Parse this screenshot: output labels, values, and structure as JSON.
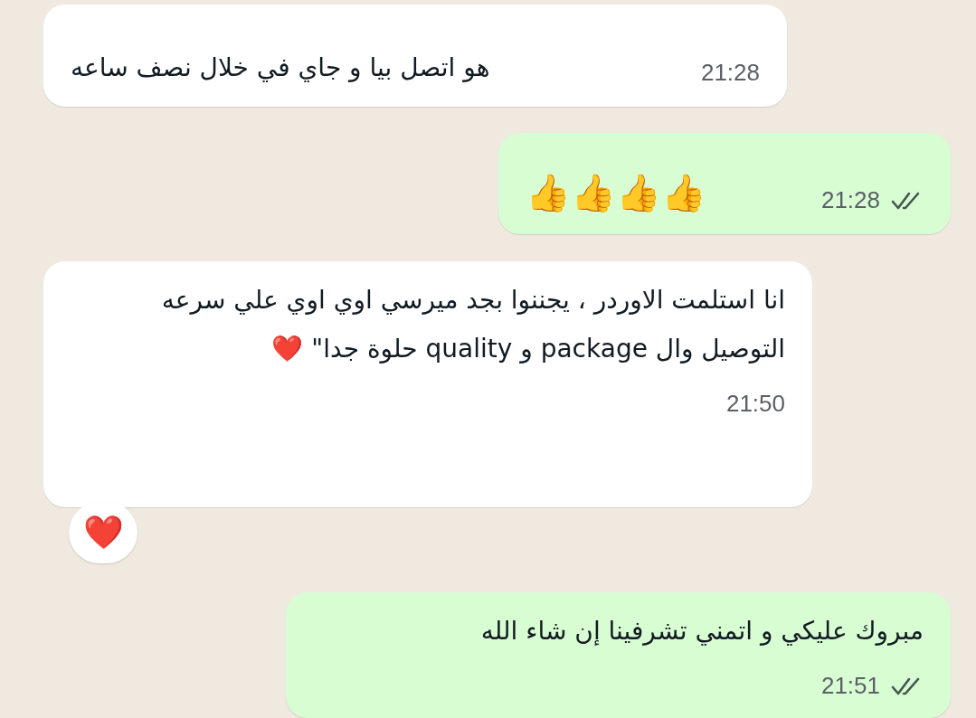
{
  "messages": [
    {
      "kind": "incoming",
      "text": "هو اتصل بيا و جاي في خلال نصف ساعه",
      "time": "21:28"
    },
    {
      "kind": "outgoing",
      "text": "👍👍👍👍",
      "time": "21:28",
      "read": false
    },
    {
      "kind": "incoming",
      "text": "انا استلمت الاوردر ، يجننوا بجد ميرسي اوي اوي علي سرعه التوصيل وال package و quality حلوة جدا\" ❤️",
      "time": "21:50",
      "reaction": "❤️"
    },
    {
      "kind": "outgoing",
      "text": "مبروك عليكي و اتمني تشرفينا إن شاء الله",
      "time": "21:51",
      "read": false
    }
  ]
}
